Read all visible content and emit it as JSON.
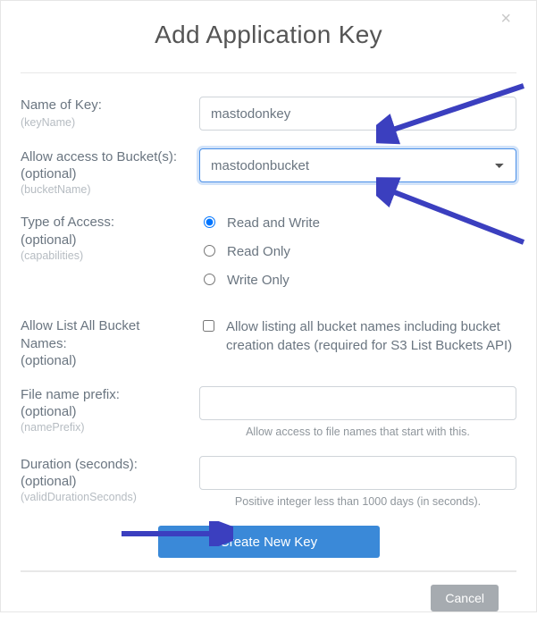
{
  "header": {
    "title": "Add Application Key",
    "close_symbol": "×"
  },
  "fields": {
    "keyName": {
      "label": "Name of Key:",
      "tech": "(keyName)",
      "value": "mastodonkey"
    },
    "bucket": {
      "label": "Allow access to Bucket(s):",
      "opt": "(optional)",
      "tech": "(bucketName)",
      "selected": "mastodonbucket"
    },
    "access": {
      "label": "Type of Access:",
      "opt": "(optional)",
      "tech": "(capabilities)",
      "options": {
        "rw": "Read and Write",
        "ro": "Read Only",
        "wo": "Write Only"
      },
      "selected": "rw"
    },
    "listAll": {
      "label": "Allow List All Bucket Names:",
      "opt": "(optional)",
      "checkbox_text": "Allow listing all bucket names including bucket creation dates (required for S3 List Buckets API)"
    },
    "prefix": {
      "label": "File name prefix:",
      "opt": "(optional)",
      "tech": "(namePrefix)",
      "value": "",
      "hint": "Allow access to file names that start with this."
    },
    "duration": {
      "label": "Duration (seconds):",
      "opt": "(optional)",
      "tech": "(validDurationSeconds)",
      "value": "",
      "hint": "Positive integer less than 1000 days (in seconds)."
    }
  },
  "buttons": {
    "create": "Create New Key",
    "cancel": "Cancel"
  }
}
